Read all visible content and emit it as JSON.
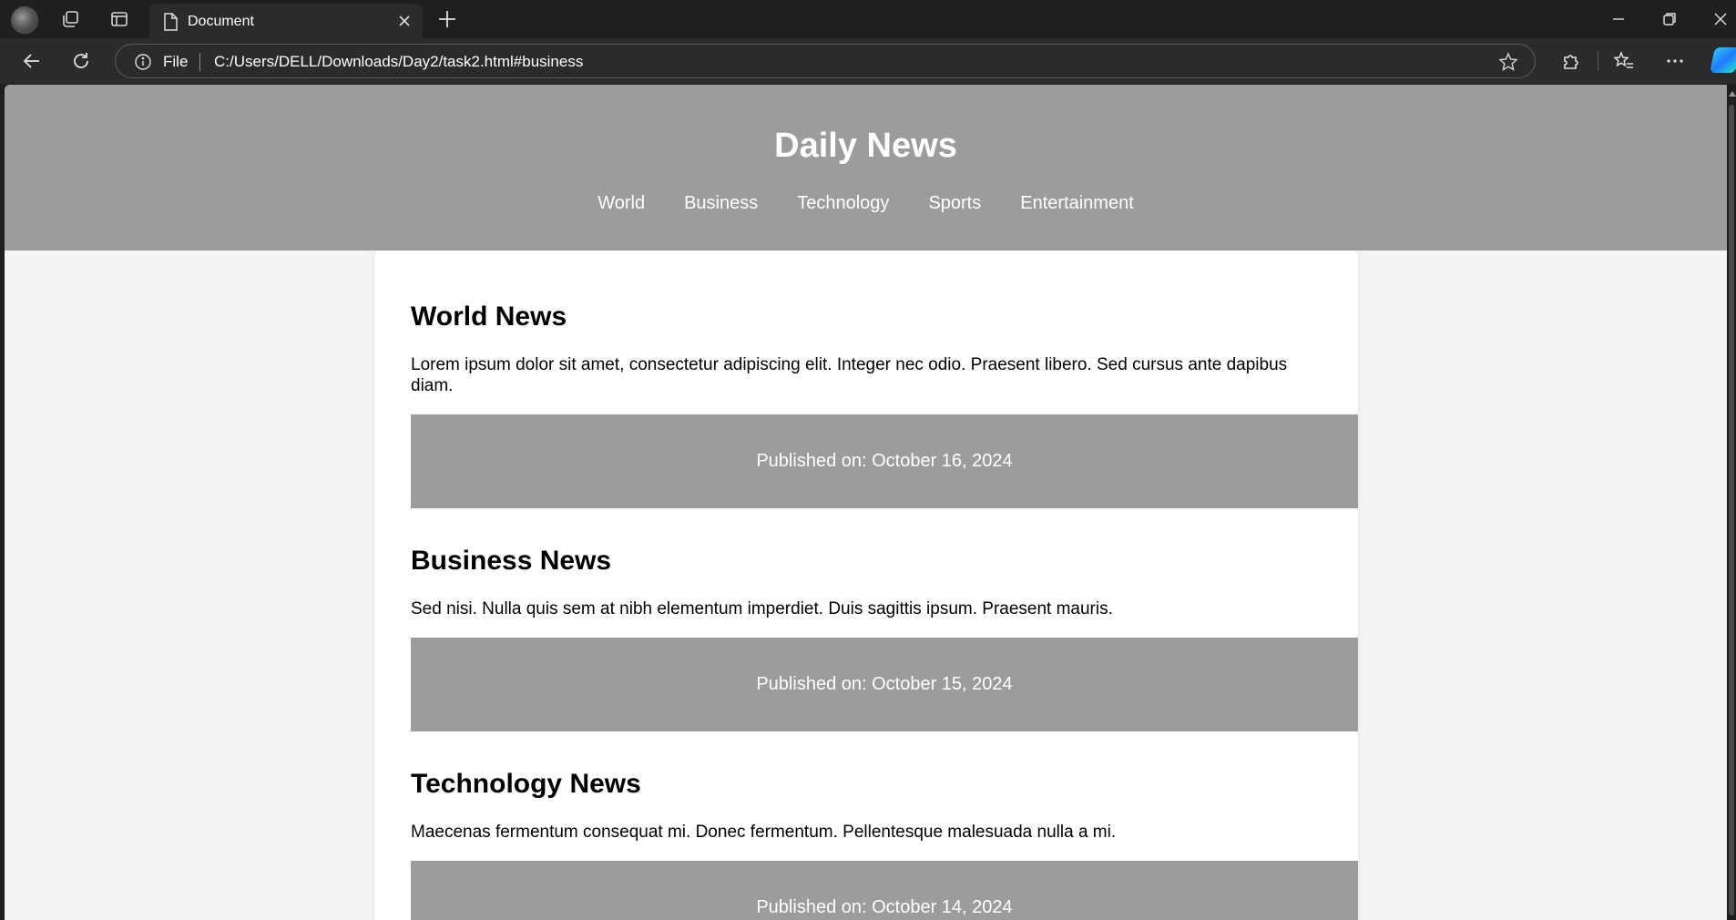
{
  "browser": {
    "tab_title": "Document",
    "address": {
      "scheme_label": "File",
      "url": "C:/Users/DELL/Downloads/Day2/task2.html#business"
    }
  },
  "page": {
    "site_title": "Daily News",
    "nav": [
      {
        "label": "World"
      },
      {
        "label": "Business"
      },
      {
        "label": "Technology"
      },
      {
        "label": "Sports"
      },
      {
        "label": "Entertainment"
      }
    ],
    "articles": [
      {
        "title": "World News",
        "body": "Lorem ipsum dolor sit amet, consectetur adipiscing elit. Integer nec odio. Praesent libero. Sed cursus ante dapibus diam.",
        "published": "Published on: October 16, 2024"
      },
      {
        "title": "Business News",
        "body": "Sed nisi. Nulla quis sem at nibh elementum imperdiet. Duis sagittis ipsum. Praesent mauris.",
        "published": "Published on: October 15, 2024"
      },
      {
        "title": "Technology News",
        "body": "Maecenas fermentum consequat mi. Donec fermentum. Pellentesque malesuada nulla a mi.",
        "published": "Published on: October 14, 2024"
      }
    ]
  },
  "colors": {
    "header_bg": "#9c9c9c",
    "page_bg": "#f4f4f4",
    "card_bg": "#ffffff",
    "browser_chrome": "#1f1f1f"
  }
}
